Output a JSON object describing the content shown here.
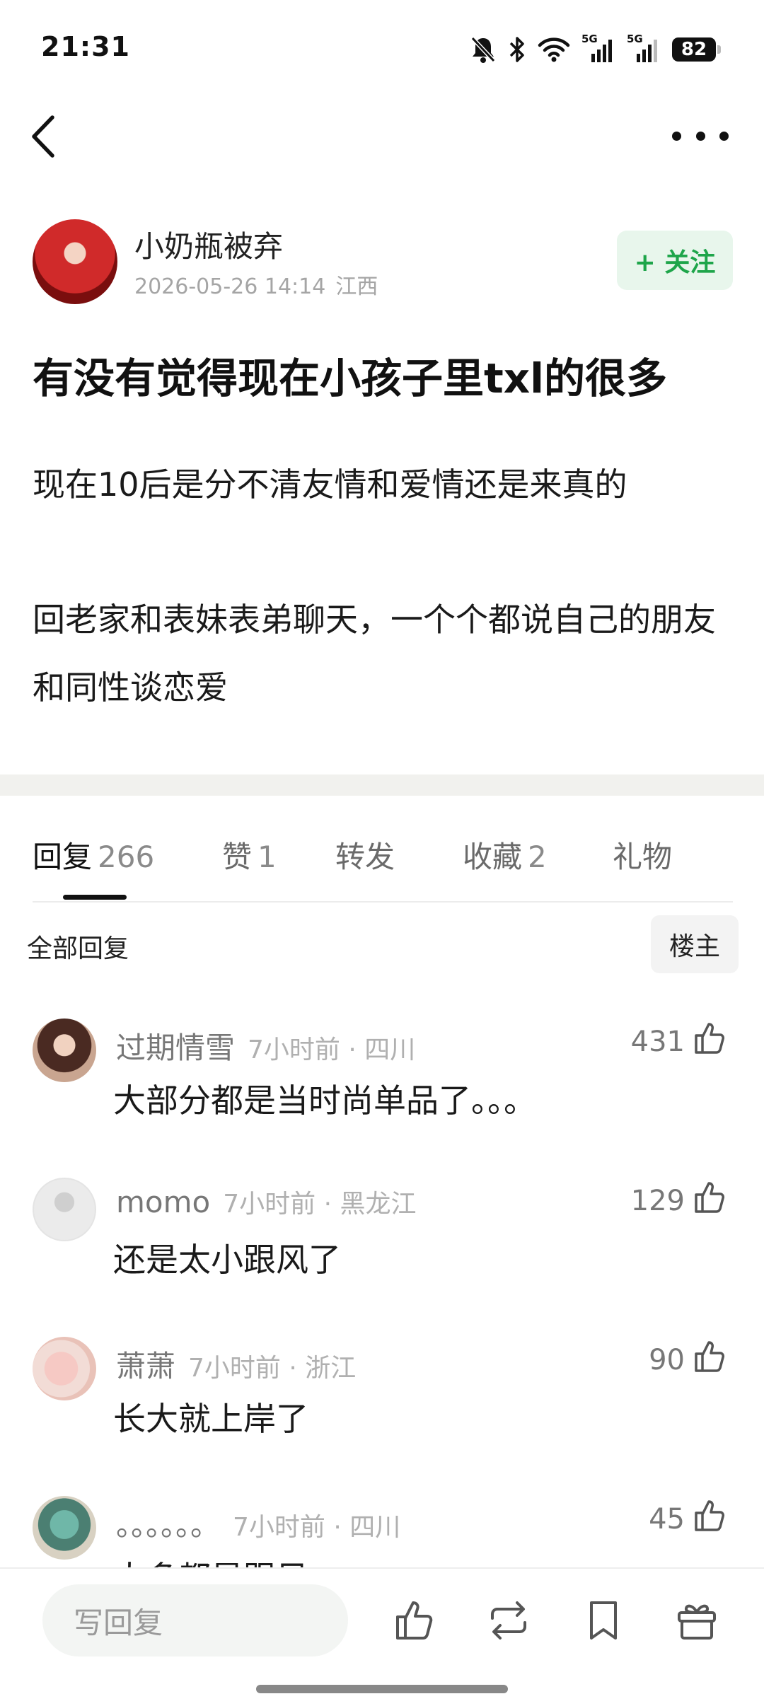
{
  "status_bar": {
    "time": "21:31",
    "net1": "5G",
    "net2": "5G",
    "battery": "82"
  },
  "post": {
    "author": "小奶瓶被弃",
    "date": "2026-05-26 14:14",
    "location": "江西",
    "follow_label": "+ 关注",
    "title": "有没有觉得现在小孩子里txl的很多",
    "paragraph1": "现在10后是分不清友情和爱情还是来真的",
    "paragraph2": "回老家和表妹表弟聊天，一个个都说自己的朋友和同性谈恋爱"
  },
  "tabs": [
    {
      "label": "回复",
      "count": "266"
    },
    {
      "label": "赞",
      "count": "1"
    },
    {
      "label": "转发",
      "count": ""
    },
    {
      "label": "收藏",
      "count": "2"
    },
    {
      "label": "礼物",
      "count": ""
    }
  ],
  "replies_header": {
    "all": "全部回复",
    "op_filter": "楼主"
  },
  "comments": [
    {
      "name": "过期情雪",
      "time": "7小时前",
      "location": "四川",
      "likes": "431",
      "text": "大部分都是当时尚单品了。。。"
    },
    {
      "name": "momo",
      "time": "7小时前",
      "location": "黑龙江",
      "likes": "129",
      "text": "还是太小跟风了"
    },
    {
      "name": "萧萧",
      "time": "7小时前",
      "location": "浙江",
      "likes": "90",
      "text": "长大就上岸了"
    },
    {
      "name": "。。。。。。",
      "time": "7小时前",
      "location": "四川",
      "likes": "45",
      "text": "大多都是跟风"
    }
  ],
  "bottom_bar": {
    "reply_placeholder": "写回复"
  },
  "colors": {
    "accent_green": "#1ea54a",
    "follow_bg": "#e8f6ec",
    "meta_gray": "#a5a5a5"
  }
}
